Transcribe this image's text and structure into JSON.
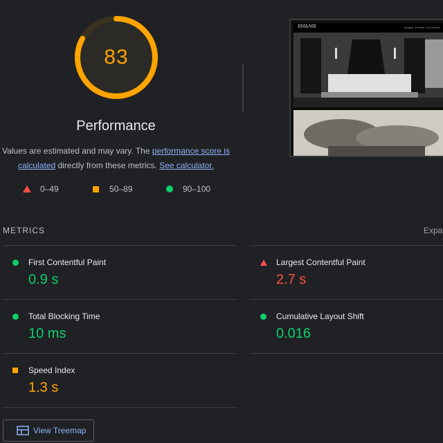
{
  "gauge": {
    "score": "83",
    "score_fraction": 0.83,
    "color": "#ffa400",
    "track": "#3a3320"
  },
  "title": "Performance",
  "description": {
    "prefix": "Values are estimated and may vary. The ",
    "link1_a": "performance score is",
    "link1_b": "calculated",
    "middle": " directly from these metrics. ",
    "link2": "See calculator."
  },
  "legend": [
    {
      "icon": "red-triangle-icon",
      "label": "0–49"
    },
    {
      "icon": "orange-square-icon",
      "label": "50–89"
    },
    {
      "icon": "green-circle-icon",
      "label": "90–100"
    }
  ],
  "screenshot": {
    "logo_text": "RM&MB",
    "nav_text": "page home contact"
  },
  "metrics_header": "METRICS",
  "expand_label": "Expand view",
  "metrics": [
    {
      "name": "First Contentful Paint",
      "value": "0.9 s",
      "status": "good"
    },
    {
      "name": "Largest Contentful Paint",
      "value": "2.7 s",
      "status": "poor"
    },
    {
      "name": "Total Blocking Time",
      "value": "10 ms",
      "status": "good"
    },
    {
      "name": "Cumulative Layout Shift",
      "value": "0.016",
      "status": "good"
    },
    {
      "name": "Speed Index",
      "value": "1.3 s",
      "status": "average"
    }
  ],
  "treemap_button": "View Treemap",
  "colors": {
    "good": "#0cce6b",
    "average": "#ffa400",
    "poor": "#ff4e42",
    "link": "#8ab4f8"
  }
}
